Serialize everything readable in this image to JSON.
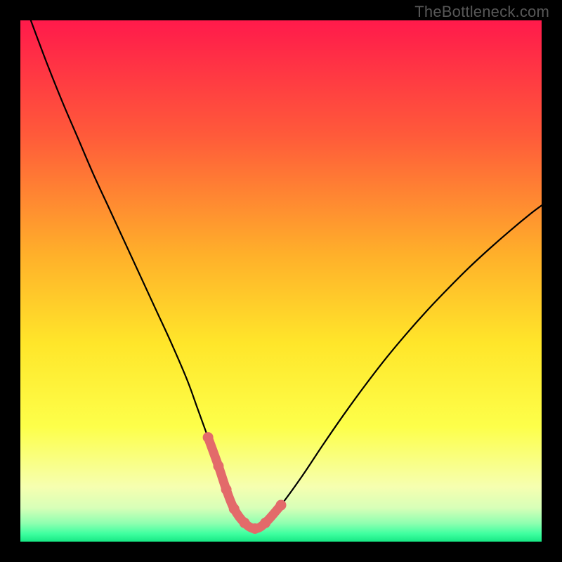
{
  "watermark": "TheBottleneck.com",
  "chart_data": {
    "type": "line",
    "title": "",
    "xlabel": "",
    "ylabel": "",
    "xlim": [
      0,
      100
    ],
    "ylim": [
      0,
      100
    ],
    "gradient_stops": [
      {
        "offset": 0,
        "color": "#ff1a4b"
      },
      {
        "offset": 0.22,
        "color": "#ff5a3a"
      },
      {
        "offset": 0.45,
        "color": "#ffb02a"
      },
      {
        "offset": 0.62,
        "color": "#ffe62a"
      },
      {
        "offset": 0.78,
        "color": "#fdff4a"
      },
      {
        "offset": 0.895,
        "color": "#f6ffb0"
      },
      {
        "offset": 0.935,
        "color": "#d8ffb8"
      },
      {
        "offset": 0.965,
        "color": "#8effb0"
      },
      {
        "offset": 0.985,
        "color": "#3effa0"
      },
      {
        "offset": 1.0,
        "color": "#17e884"
      }
    ],
    "series": [
      {
        "name": "bottleneck-curve",
        "x": [
          2,
          5,
          8,
          11,
          14,
          17,
          20,
          23,
          26,
          29,
          32,
          34,
          36,
          38,
          39.5,
          41,
          43,
          45,
          47,
          50,
          54,
          58,
          62,
          66,
          70,
          74,
          78,
          82,
          86,
          90,
          94,
          98,
          100
        ],
        "y": [
          100,
          92,
          84.5,
          77.5,
          70.5,
          64,
          57.5,
          51,
          44.5,
          38,
          31,
          25.5,
          20,
          14.5,
          10,
          6.3,
          3.6,
          2.5,
          3.6,
          7,
          12.5,
          18.5,
          24.3,
          29.8,
          35,
          39.8,
          44.3,
          48.5,
          52.5,
          56.2,
          59.7,
          63,
          64.5
        ]
      },
      {
        "name": "optimal-range-highlight",
        "color": "#e36a6a",
        "x": [
          36,
          38,
          39.5,
          41,
          43,
          45,
          47,
          50
        ],
        "y": [
          20,
          14.5,
          10,
          6.3,
          3.6,
          2.5,
          3.6,
          7
        ]
      }
    ]
  }
}
